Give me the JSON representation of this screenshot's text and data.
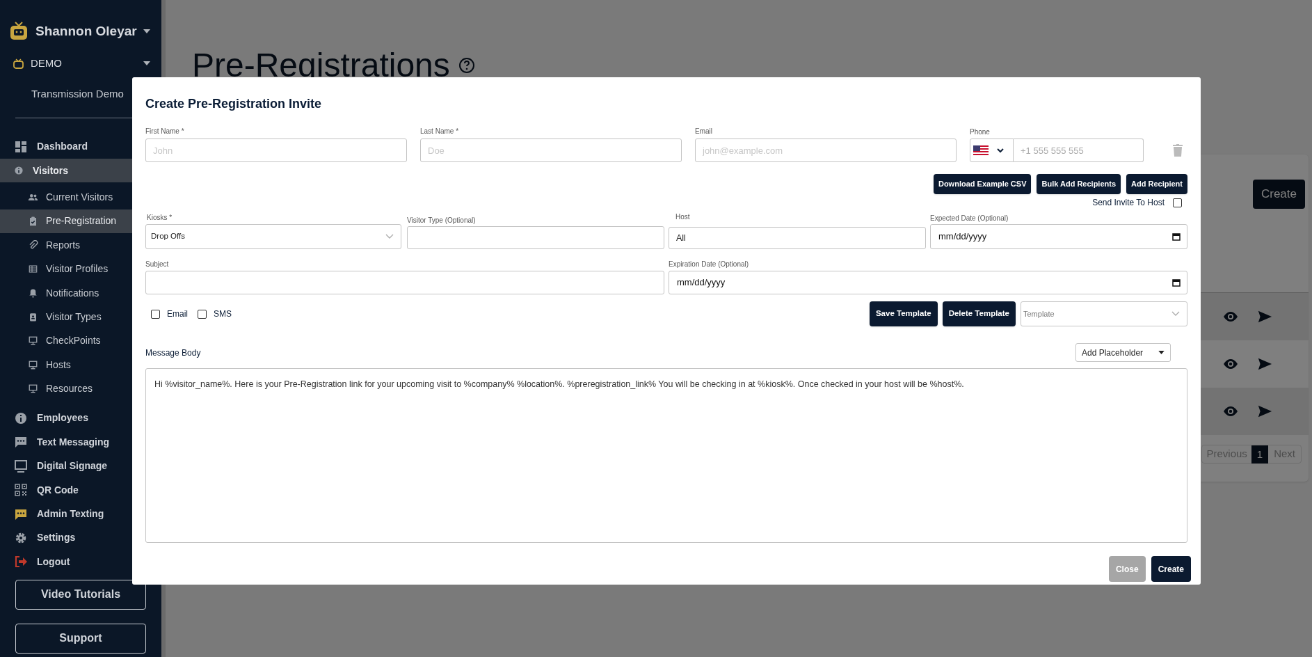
{
  "sidebar": {
    "account": {
      "name": "Shannon Oleyar"
    },
    "organization": {
      "name": "DEMO",
      "location": "Transmission Demo"
    },
    "items": [
      {
        "label": "Dashboard",
        "selected": false
      },
      {
        "label": "Visitors",
        "selected": true,
        "children": [
          {
            "label": "Current Visitors",
            "selected": false
          },
          {
            "label": "Pre-Registration",
            "selected": true
          },
          {
            "label": "Reports",
            "selected": false
          },
          {
            "label": "Visitor Profiles",
            "selected": false
          },
          {
            "label": "Notifications",
            "selected": false
          },
          {
            "label": "Visitor Types",
            "selected": false
          },
          {
            "label": "CheckPoints",
            "selected": false
          },
          {
            "label": "Hosts",
            "selected": false
          },
          {
            "label": "Resources",
            "selected": false
          }
        ]
      },
      {
        "label": "Employees",
        "selected": false
      },
      {
        "label": "Text Messaging",
        "selected": false
      },
      {
        "label": "Digital Signage",
        "selected": false
      },
      {
        "label": "QR Code",
        "selected": false
      },
      {
        "label": "Admin Texting",
        "selected": false
      },
      {
        "label": "Settings",
        "selected": false
      },
      {
        "label": "Logout",
        "selected": false
      }
    ],
    "buttons": [
      "Video Tutorials",
      "Support"
    ]
  },
  "page": {
    "title": "Pre-Registrations",
    "create_button": "Create",
    "pagination": {
      "previous": "Previous",
      "pages": [
        {
          "label": "1",
          "selected": true
        }
      ],
      "next": "Next"
    }
  },
  "modal": {
    "title": "Create Pre-Registration Invite",
    "recipient": [
      {
        "label": "First Name *",
        "placeholder": "John"
      },
      {
        "label": "Last Name *",
        "placeholder": "Doe"
      },
      {
        "label": "Email",
        "placeholder": "john@example.com"
      }
    ],
    "phone": {
      "label": "Phone",
      "placeholder": "+1 555 555 555"
    },
    "recipient_buttons": [
      "Download Example CSV",
      "Bulk Add Recipients",
      "Add Recipient"
    ],
    "send_invite_to_host": {
      "label": "Send Invite To Host",
      "checked": false
    },
    "kiosks": {
      "label": "Kiosks *",
      "value": "Drop Offs"
    },
    "visitor_type": {
      "label": "Visitor Type (Optional)"
    },
    "host": {
      "label": "Host",
      "value": "All"
    },
    "expected_date": {
      "label": "Expected Date (Optional)",
      "value": "mm/dd/yyyy"
    },
    "subject": {
      "label": "Subject"
    },
    "expiration_date": {
      "label": "Expiration Date (Optional)",
      "value": "mm/dd/yyyy"
    },
    "channels": [
      {
        "label": "Email",
        "checked": false
      },
      {
        "label": "SMS",
        "checked": false
      }
    ],
    "template_buttons": [
      "Save Template",
      "Delete Template"
    ],
    "template": {
      "placeholder": "Template"
    },
    "message_body": {
      "label": "Message Body",
      "value": "Hi %visitor_name%. Here is your Pre-Registration link for your upcoming visit to %company% %location%. %preregistration_link% You will be checking in at %kiosk%. Once checked in your host will be %host%."
    },
    "add_placeholder": "Add Placeholder",
    "footer_buttons": [
      {
        "label": "Close",
        "kind": "secondary"
      },
      {
        "label": "Create",
        "kind": "primary"
      }
    ]
  }
}
